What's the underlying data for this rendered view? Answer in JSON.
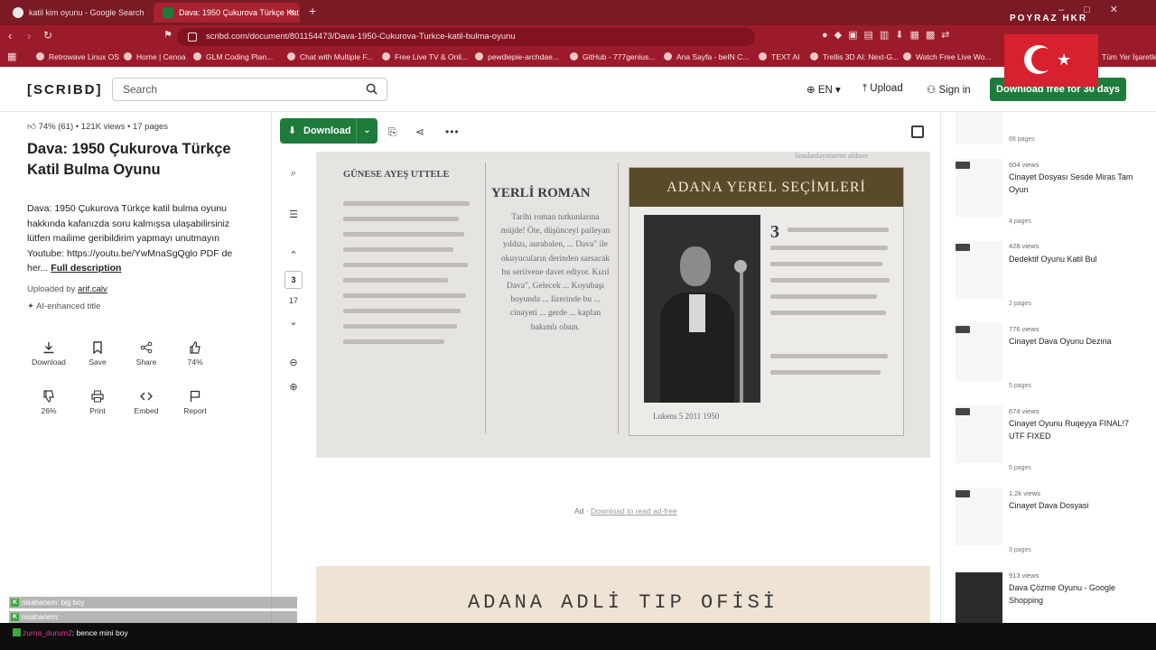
{
  "browser": {
    "tabs": [
      {
        "title": "katil kim oyunu - Google Search"
      },
      {
        "title": "Dava: 1950 Çukurova Türkçe Kat"
      }
    ],
    "url": "scribd.com/document/801154473/Dava-1950-Cukurova-Turkce-katil-bulma-oyunu",
    "overlay_name": "POYRAZ HKR",
    "bookmarks": [
      "Retrowave Linux OS",
      "Home | Cenoa",
      "GLM Coding Plan...",
      "Chat with Multiple F...",
      "Free Live TV & Onli...",
      "pewdiepie-archdae...",
      "GitHub - 777genius...",
      "Ana Sayfa - beIN C...",
      "TEXT AI",
      "Trellis 3D AI: Next-G...",
      "Watch Free Live Wo...",
      "Tüm Yer İşaretleri"
    ]
  },
  "header": {
    "logo": "[SCRIBD]",
    "search_placeholder": "Search",
    "language": "EN",
    "upload": "Upload",
    "signin": "Sign in",
    "cta": "Download free for 30 days"
  },
  "doc": {
    "rating": "74% (61)",
    "views": "121K views",
    "pages": "17 pages",
    "title": "Dava: 1950 Çukurova Türkçe Katil Bulma Oyunu",
    "description": "Dava: 1950 Çukurova Türkçe katil bulma oyunu hakkında kafanızda soru kalmışsa ulaşabilirsiniz lütfen mailime geribildirim yapmayı unutmayın Youtube: https://youtu.be/YwMnaSgQglo PDF de her...",
    "full_desc": "Full description",
    "uploaded_by_label": "Uploaded by",
    "uploader": "arif.calv",
    "ai_title": "AI-enhanced title",
    "actions": [
      {
        "label": "Download",
        "icon": "download-icon"
      },
      {
        "label": "Save",
        "icon": "bookmark-icon"
      },
      {
        "label": "Share",
        "icon": "share-icon"
      },
      {
        "label": "74%",
        "icon": "thumbs-up-icon"
      },
      {
        "label": "26%",
        "icon": "thumbs-down-icon"
      },
      {
        "label": "Print",
        "icon": "print-icon"
      },
      {
        "label": "Embed",
        "icon": "embed-icon"
      },
      {
        "label": "Report",
        "icon": "flag-icon"
      }
    ]
  },
  "viewer": {
    "download_label": "Download",
    "current_page": "3",
    "total_pages": "17",
    "page_content": {
      "top_line": "fanulardayoturme afdmer",
      "col1_title": "GÜNESE AYEŞ UTTELE",
      "col2_title": "YERLİ ROMAN",
      "col2_body": "Tarihi roman tutkunlarına müjde! Öte, düşünceyi paileyan yıldızı, aurabalen, ... Dava\" ile okuyucuların derinden sarsacak bu seriivene davet ediyor. Kızıl Dava\", Gelecek ... Koyubaşı boyunda ... lizerinde bu ... cinayeti ... gerde ... kaplan bakımlı olsun.",
      "photo_header": "ADANA YEREL SEÇİMLERİ",
      "big_num": "3",
      "caption": "Lukens 5 2011 1950"
    },
    "ad_text": "Ad",
    "ad_link": "Download to read ad-free",
    "next_page_title": "ADANA ADLİ TIP OFİSİ"
  },
  "related": [
    {
      "pages": "68 pages",
      "views": "",
      "title": ""
    },
    {
      "pages": "4 pages",
      "views": "604 views",
      "title": "Cinayet Dosyası Sesde Miras Tam Oyun"
    },
    {
      "pages": "2 pages",
      "views": "428 views",
      "title": "Dedektif Oyunu Katil Bul"
    },
    {
      "pages": "5 pages",
      "views": "776 views",
      "title": "Cinayet Dava Oyunu Deziria"
    },
    {
      "pages": "5 pages",
      "views": "674 views",
      "title": "Cinayet Oyunu Ruqeyya FINAL!7 UTF FIXED"
    },
    {
      "pages": "3 pages",
      "views": "1.2k views",
      "title": "Cinayet Dava Dosyasi"
    },
    {
      "pages": "",
      "views": "913 views",
      "title": "Dava Çözme Oyunu - Google Shopping"
    }
  ],
  "chat": [
    {
      "user": "nisahanem",
      "msg": ": big boy"
    },
    {
      "user": "nisahanem",
      "msg": ":"
    },
    {
      "user": "zurna_durum2",
      "msg": ": bence mini boy"
    }
  ],
  "colors": {
    "brand_green": "#1e7b3c",
    "tab_red": "#9c1b2a"
  }
}
